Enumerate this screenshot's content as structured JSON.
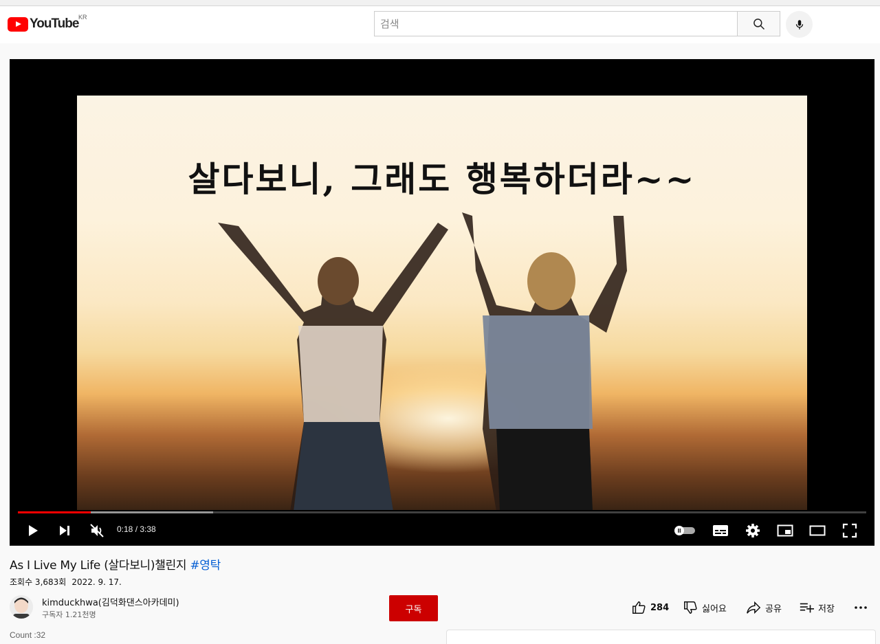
{
  "masthead": {
    "logo_text": "YouTube",
    "country_code": "KR",
    "search_placeholder": "검색",
    "icons": {
      "search": "search-icon",
      "mic": "mic-icon"
    }
  },
  "player": {
    "caption_text": "살다보니, 그래도 행복하더라~~",
    "time_current": "0:18",
    "time_separator": " / ",
    "time_total": "3:38",
    "progress_played_fraction": 0.086,
    "progress_buffered_fraction": 0.23,
    "accent_color": "#ff0000",
    "icons": [
      "play-icon",
      "next-icon",
      "mute-icon",
      "autoplay-toggle",
      "subtitles-icon",
      "settings-icon",
      "miniplayer-icon",
      "theater-icon",
      "fullscreen-icon"
    ]
  },
  "video": {
    "title": "As I Live My Life (살다보니)챌린지 ",
    "hashtag": "#영탁",
    "views": "조회수 3,683회",
    "date": "2022. 9. 17."
  },
  "channel": {
    "name": "kimduckhwa(김덕화댄스아카데미)",
    "subscribers": "구독자 1.21천명",
    "subscribe_label": "구독",
    "subscribe_color": "#cc0000"
  },
  "actions": {
    "like_count": "284",
    "dislike_label": "싫어요",
    "share_label": "공유",
    "save_label": "저장",
    "more_icon": "more-icon"
  },
  "count_text": "Count :32"
}
